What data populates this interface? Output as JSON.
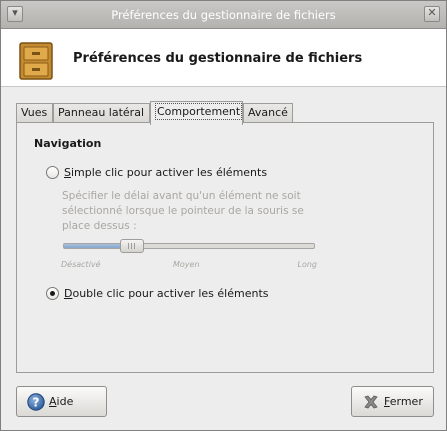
{
  "window": {
    "title": "Préférences du gestionnaire de fichiers"
  },
  "header": {
    "heading": "Préférences du gestionnaire de fichiers",
    "icon": "file-cabinet-icon"
  },
  "tabs": [
    {
      "label": "Vues",
      "active": false
    },
    {
      "label": "Panneau latéral",
      "active": false
    },
    {
      "label": "Comportement",
      "active": true
    },
    {
      "label": "Avancé",
      "active": false
    }
  ],
  "navigation": {
    "section_title": "Navigation",
    "single_click": {
      "mnemonic": "S",
      "rest": "imple clic pour activer les éléments",
      "selected": false
    },
    "description": "Spécifier le délai avant qu'un élément ne soit sélectionné lorsque le pointeur de la souris se place dessus :",
    "slider": {
      "value": 0.27,
      "labels": [
        "Désactivé",
        "Moyen",
        "Long"
      ],
      "enabled": false
    },
    "double_click": {
      "mnemonic": "D",
      "rest": "ouble clic pour activer les éléments",
      "selected": true
    }
  },
  "buttons": {
    "help": {
      "mnemonic": "A",
      "rest": "ide",
      "icon": "help-icon"
    },
    "close": {
      "mnemonic": "F",
      "rest": "ermer",
      "icon": "close-x-icon"
    }
  },
  "colors": {
    "accent": "#86a6cb",
    "window_bg": "#eeeded",
    "titlebar": "#b3b2ae",
    "disabled_text": "#a8a7a3"
  }
}
